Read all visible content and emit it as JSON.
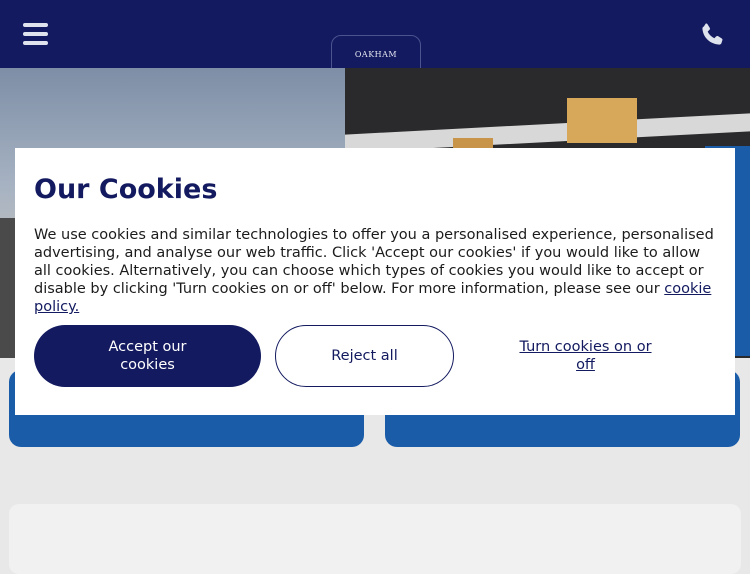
{
  "header": {
    "logo_text": "OAKHAM",
    "menu_icon": "hamburger-menu-icon",
    "phone_icon": "phone-icon"
  },
  "colors": {
    "brand_navy": "#131a5f",
    "accent_blue": "#1a5ca8",
    "dialog_bg": "#ffffff"
  },
  "cookie_dialog": {
    "title": "Our Cookies",
    "body": "We use cookies and similar technologies to offer you a personalised experience, personalised advertising, and analyse our web traffic. Click 'Accept our cookies' if you would like to allow all cookies. Alternatively, you can choose which types of cookies you would like to accept or disable by clicking 'Turn cookies on or off' below. For more information, please see our ",
    "policy_link": "cookie policy.",
    "accept_label": "Accept our cookies",
    "reject_label": "Reject all",
    "toggle_label": "Turn cookies on or off"
  }
}
